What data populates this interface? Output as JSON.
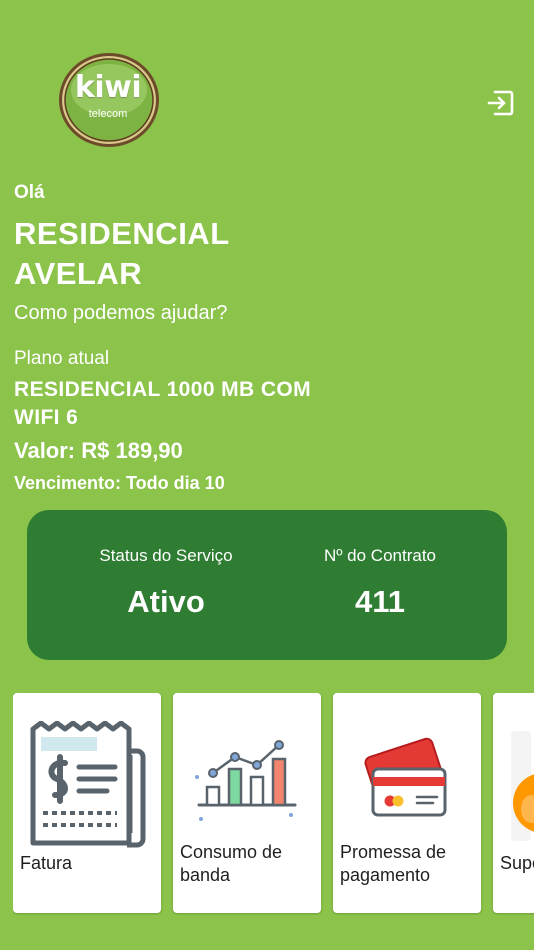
{
  "logo": {
    "name": "kiwi",
    "subtitle": "telecom"
  },
  "greeting": {
    "hello": "Olá",
    "client_name": "RESIDENCIAL AVELAR",
    "help_text": "Como podemos ajudar?"
  },
  "plan": {
    "label": "Plano atual",
    "name": "RESIDENCIAL 1000 MB COM WIFI 6",
    "price": "Valor: R$ 189,90",
    "due": "Vencimento: Todo dia 10"
  },
  "status": {
    "service_label": "Status do Serviço",
    "service_value": "Ativo",
    "contract_label": "Nº do Contrato",
    "contract_value": "411"
  },
  "menu": {
    "items": [
      {
        "label": "Fatura",
        "icon": "invoice-icon"
      },
      {
        "label": "Consumo de banda",
        "icon": "bandwidth-chart-icon"
      },
      {
        "label": "Promessa de pagamento",
        "icon": "credit-card-icon"
      },
      {
        "label": "Suporte",
        "icon": "support-icon"
      }
    ]
  },
  "colors": {
    "background": "#8cc34b",
    "card": "#2e7d32",
    "text": "#ffffff",
    "tile": "#ffffff"
  }
}
